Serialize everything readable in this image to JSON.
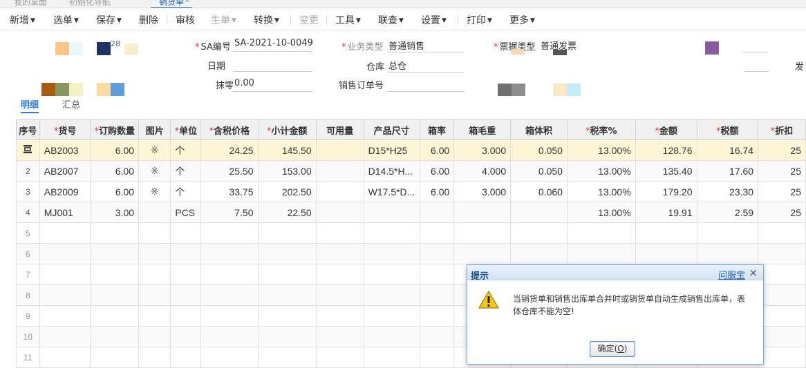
{
  "tabs": [
    {
      "label": "我的桌面"
    },
    {
      "label": "初始化导航"
    },
    {
      "label": "销货单",
      "active": true
    }
  ],
  "toolbar": [
    {
      "label": "新增",
      "caret": true,
      "disabled": false
    },
    {
      "label": "选单",
      "caret": true,
      "disabled": false
    },
    {
      "label": "保存",
      "caret": true,
      "disabled": false
    },
    {
      "label": "删除",
      "caret": false,
      "disabled": false
    },
    {
      "label": "审核",
      "caret": false,
      "disabled": false
    },
    {
      "label": "生单",
      "caret": true,
      "disabled": true
    },
    {
      "label": "转换",
      "caret": true,
      "disabled": false
    },
    {
      "label": "变更",
      "caret": false,
      "disabled": true
    },
    {
      "label": "工具",
      "caret": true,
      "disabled": false
    },
    {
      "label": "联查",
      "caret": true,
      "disabled": false
    },
    {
      "label": "设置",
      "caret": true,
      "disabled": false
    },
    {
      "label": "打印",
      "caret": true,
      "disabled": false
    },
    {
      "label": "更多",
      "caret": true,
      "disabled": false
    }
  ],
  "form": {
    "top_left_fragment": "28",
    "sa_no_label": "SA编号",
    "sa_no_value": "SA-2021-10-0049",
    "biz_type_label": "业务类型",
    "biz_type_value": "普通销售",
    "invoice_type_label": "票据类型",
    "invoice_type_value": "普通发票",
    "date_label": "日期",
    "warehouse_label": "仓库",
    "warehouse_value": "总仓",
    "round_label": "抹零",
    "round_value": "0.00",
    "sales_order_label": "销售订单号",
    "right_label": "发"
  },
  "subtabs": [
    {
      "label": "明细",
      "active": true
    },
    {
      "label": "汇总",
      "active": false
    }
  ],
  "columns": [
    {
      "label": "序号",
      "req": false
    },
    {
      "label": "货号",
      "req": true
    },
    {
      "label": "订购数量",
      "req": true
    },
    {
      "label": "图片",
      "req": false
    },
    {
      "label": "单位",
      "req": true
    },
    {
      "label": "含税价格",
      "req": true
    },
    {
      "label": "小计金额",
      "req": true
    },
    {
      "label": "可用量",
      "req": false
    },
    {
      "label": "产品尺寸",
      "req": false
    },
    {
      "label": "箱率",
      "req": false
    },
    {
      "label": "箱毛重",
      "req": false
    },
    {
      "label": "箱体积",
      "req": false
    },
    {
      "label": "税率%",
      "req": true
    },
    {
      "label": "金额",
      "req": true
    },
    {
      "label": "税额",
      "req": true
    },
    {
      "label": "折扣",
      "req": true
    }
  ],
  "rows": [
    {
      "no": "",
      "code": "AB2003",
      "qty": "6.00",
      "pic": "※",
      "unit": "个",
      "price": "24.25",
      "subtotal": "145.50",
      "avail": "",
      "size": "D15*H25",
      "box_rate": "6.00",
      "box_weight": "3.000",
      "box_vol": "0.050",
      "tax_rate": "13.00%",
      "amount": "128.76",
      "tax": "16.74",
      "discount": "25"
    },
    {
      "no": "2",
      "code": "AB2007",
      "qty": "6.00",
      "pic": "※",
      "unit": "个",
      "price": "25.50",
      "subtotal": "153.00",
      "avail": "",
      "size": "D14.5*H...",
      "box_rate": "6.00",
      "box_weight": "4.000",
      "box_vol": "0.050",
      "tax_rate": "13.00%",
      "amount": "135.40",
      "tax": "17.60",
      "discount": "25"
    },
    {
      "no": "3",
      "code": "AB2009",
      "qty": "6.00",
      "pic": "※",
      "unit": "个",
      "price": "33.75",
      "subtotal": "202.50",
      "avail": "",
      "size": "W17.5*D...",
      "box_rate": "6.00",
      "box_weight": "3.000",
      "box_vol": "0.060",
      "tax_rate": "13.00%",
      "amount": "179.20",
      "tax": "23.30",
      "discount": "25"
    },
    {
      "no": "4",
      "code": "MJ001",
      "qty": "3.00",
      "pic": "",
      "unit": "PCS",
      "price": "7.50",
      "subtotal": "22.50",
      "avail": "",
      "size": "",
      "box_rate": "",
      "box_weight": "",
      "box_vol": "",
      "tax_rate": "13.00%",
      "amount": "19.91",
      "tax": "2.59",
      "discount": "25"
    }
  ],
  "empty_rows": [
    "5",
    "6",
    "7",
    "8",
    "9",
    "10",
    "11"
  ],
  "dialog": {
    "title": "提示",
    "help": "问服宝",
    "close": "×",
    "message": "当销货单和销售出库单合并时或销货单自动生成销售出库单，表体仓库不能为空!",
    "ok_text": "确定(",
    "ok_key": "O",
    "ok_end": ")"
  },
  "colors": {
    "accent": "#2f7ad6",
    "required": "#e33333",
    "selected_row": "#fdf5d6"
  },
  "icons": {
    "row_edit": "row-edit-icon",
    "warning": "warning-icon",
    "close": "close-icon"
  }
}
